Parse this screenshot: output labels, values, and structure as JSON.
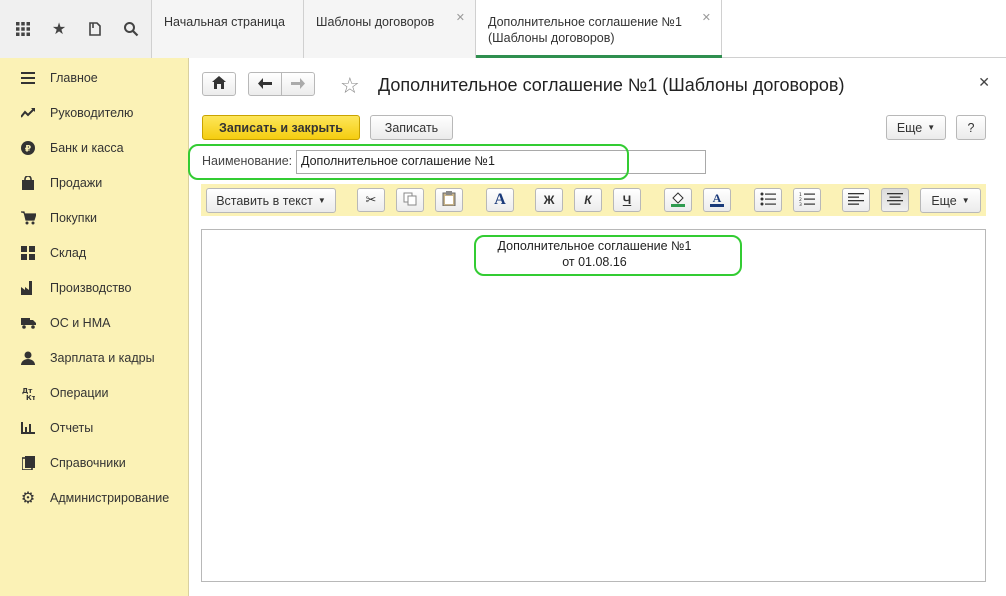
{
  "topbar": {
    "icons": [
      "apps-grid-icon",
      "star-icon",
      "history-icon",
      "search-icon"
    ],
    "tabs": [
      {
        "label": "Начальная страница"
      },
      {
        "label": "Шаблоны договоров"
      },
      {
        "label_line1": "Дополнительное соглашение №1",
        "label_line2": "(Шаблоны договоров)"
      }
    ]
  },
  "sidebar": {
    "items": [
      {
        "label": "Главное",
        "icon": "menu-icon"
      },
      {
        "label": "Руководителю",
        "icon": "trend-icon"
      },
      {
        "label": "Банк и касса",
        "icon": "ruble-icon"
      },
      {
        "label": "Продажи",
        "icon": "bag-icon"
      },
      {
        "label": "Покупки",
        "icon": "cart-icon"
      },
      {
        "label": "Склад",
        "icon": "warehouse-icon"
      },
      {
        "label": "Производство",
        "icon": "factory-icon"
      },
      {
        "label": "ОС и НМА",
        "icon": "truck-icon"
      },
      {
        "label": "Зарплата и кадры",
        "icon": "person-icon"
      },
      {
        "label": "Операции",
        "icon": "debit-credit-icon"
      },
      {
        "label": "Отчеты",
        "icon": "bar-chart-icon"
      },
      {
        "label": "Справочники",
        "icon": "book-icon"
      },
      {
        "label": "Администрирование",
        "icon": "gear-icon"
      }
    ]
  },
  "form": {
    "title": "Дополнительное соглашение №1 (Шаблоны договоров)",
    "save_close_label": "Записать и закрыть",
    "save_label": "Записать",
    "more_label": "Еще",
    "help_label": "?",
    "name_label": "Наименование:",
    "name_value": "Дополнительное соглашение №1"
  },
  "toolbar": {
    "insert_label": "Вставить в текст",
    "more_label": "Еще",
    "bold": "Ж",
    "italic": "К",
    "underline": "Ч",
    "font": "A"
  },
  "document": {
    "line1": "Дополнительное соглашение №1",
    "line2": "от 01.08.16"
  },
  "colors": {
    "sidebar_bg": "#fbf2b6",
    "primary_button": "#f5cd10",
    "highlight": "#33cc33",
    "active_tab_underline": "#2f8f4f"
  }
}
